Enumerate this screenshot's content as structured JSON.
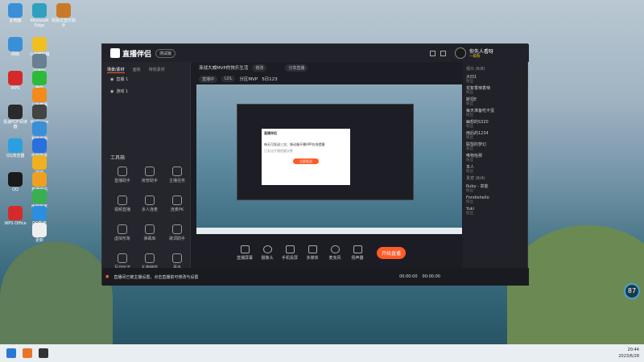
{
  "desktop": {
    "icons": [
      {
        "label": "此电脑",
        "color": "#3a8fd8"
      },
      {
        "label": "Microsoft Edge",
        "color": "#2fa0c0"
      },
      {
        "label": "网易云音乐助手",
        "color": "#c97a28"
      },
      {
        "label": "网络",
        "color": "#3a8fd8"
      },
      {
        "label": "小鸡模拟器",
        "color": "#f0c020"
      },
      {
        "label": "回收站",
        "color": "#6a7f8f"
      },
      {
        "label": "WPS",
        "color": "#d52a2a"
      },
      {
        "label": "微信",
        "color": "#2dba3a"
      },
      {
        "label": "斗鱼直播",
        "color": "#f28b1a"
      },
      {
        "label": "极速PDF阅读器",
        "color": "#2a2a2a"
      },
      {
        "label": "WeGame",
        "color": "#444"
      },
      {
        "label": "我的文档",
        "color": "#3a8fd8"
      },
      {
        "label": "QQ浏览器",
        "color": "#2aa0e0"
      },
      {
        "label": "电脑管家",
        "color": "#2a6fe0"
      },
      {
        "label": "PDF",
        "color": "#f0b020"
      },
      {
        "label": "QQ",
        "color": "#1a1a1a"
      },
      {
        "label": "直播伴侣",
        "color": "#f0a020"
      },
      {
        "label": "电脑管家",
        "color": "#38b050"
      },
      {
        "label": "WPS Office",
        "color": "#d52a2a"
      },
      {
        "label": "QQ影音",
        "color": "#2a8fe0"
      },
      {
        "label": "更新",
        "color": "#eee"
      }
    ]
  },
  "app": {
    "logo": "直播伴侣",
    "version_pill": "测试版",
    "sidebar_tabs": [
      "场景/素材",
      "面板",
      "特效素材"
    ],
    "scenes": [
      "直播 1",
      "游戏 1"
    ],
    "tools_title": "工具箱",
    "tools": [
      "直播助手",
      "房管助手",
      "主播任务",
      "视频直播",
      "多人连麦",
      "连麦PK",
      "虚拟形象",
      "弹幕库",
      "歌词助手",
      "互动玩法",
      "礼物特效",
      "更多"
    ],
    "stream_title": "渐战大威MVP的快乐生活",
    "title_badges": [
      "修改",
      "分享直播"
    ],
    "meta_badges": [
      "直播中",
      "LOL",
      "分区MVP",
      "5日123"
    ],
    "inner_popup_title": "直播伴侣",
    "inner_popup_text": "每天可发送三次，移动端开播APP在线提醒",
    "inner_popup_sub": "已发送开播提醒次数",
    "inner_popup_btn": "立即发送",
    "bottom_buttons": [
      "直播屏幕",
      "摄像头",
      "手机投屏",
      "多媒体",
      "麦克风",
      "扬声器"
    ],
    "start_live": "开始直播",
    "status_text": "直播间已被主播设置，点击直播前可修改与设置",
    "status_time": "00:00:00",
    "status_time2": "00:00:00",
    "chat_header": "你先人看呀",
    "chat_sub": "一级粉",
    "chat_section": "观众 (6/8)",
    "chat_items": [
      {
        "name": "大凹1",
        "sub": "粉丝"
      },
      {
        "name": "花絮香辣香辣",
        "sub": "粉丝"
      },
      {
        "name": "斯坦E",
        "sub": "粉丝"
      },
      {
        "name": "每天准备吃不蛋",
        "sub": "粉丝"
      },
      {
        "name": "幽想的S320",
        "sub": "粉丝"
      },
      {
        "name": "雨后的1234",
        "sub": "粉丝"
      },
      {
        "name": "联盟的梦幻",
        "sub": "粉丝"
      },
      {
        "name": "唯物恰那",
        "sub": "粉丝"
      },
      {
        "name": "本人",
        "sub": "粉丝"
      }
    ],
    "chat_section2": "贵宾 (8/4)",
    "chat_items2": [
      {
        "name": "Ruby - 高能",
        "sub": "粉丝"
      },
      {
        "name": "Fondiehello",
        "sub": "粉丝"
      },
      {
        "name": "Yuki",
        "sub": "粉丝"
      }
    ]
  },
  "gauge": {
    "value": "87"
  },
  "taskbar": {
    "time": "20:44",
    "date": "2023/6/28"
  }
}
